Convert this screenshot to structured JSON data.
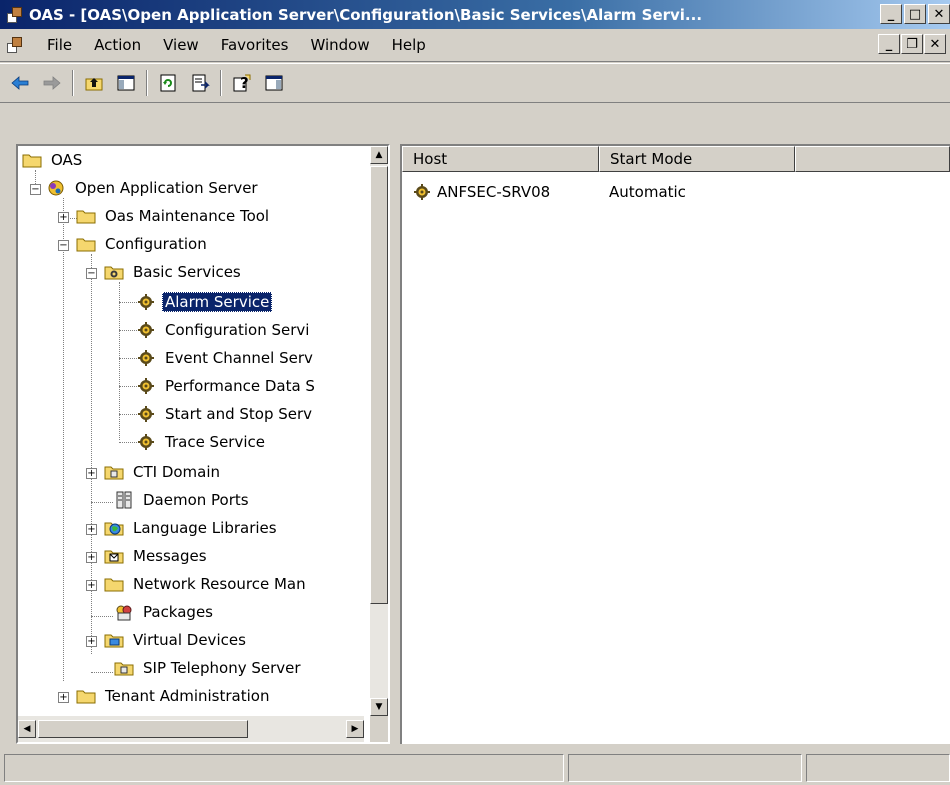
{
  "window": {
    "title": "OAS - [OAS\\Open Application Server\\Configuration\\Basic Services\\Alarm Servi...",
    "minimize": "_",
    "maximize": "□",
    "close": "✕"
  },
  "menubar": {
    "items": [
      {
        "label": "File"
      },
      {
        "label": "Action"
      },
      {
        "label": "View"
      },
      {
        "label": "Favorites"
      },
      {
        "label": "Window"
      },
      {
        "label": "Help"
      }
    ],
    "mdi_minimize": "_",
    "mdi_restore": "❐",
    "mdi_close": "✕"
  },
  "toolbar": {
    "icons": [
      "back-arrow-icon",
      "forward-arrow-icon",
      "up-one-level-icon",
      "show-hide-tree-icon",
      "refresh-icon",
      "export-list-icon",
      "help-icon",
      "show-hide-action-pane-icon"
    ]
  },
  "tree": {
    "items": [
      {
        "label": "OAS",
        "icon": "folder-icon",
        "selected": false
      },
      {
        "label": "Open Application Server",
        "icon": "server-icon",
        "expanded": true
      },
      {
        "label": "Oas Maintenance Tool",
        "icon": "folder-icon",
        "expanded": false
      },
      {
        "label": "Configuration",
        "icon": "folder-icon",
        "expanded": true
      },
      {
        "label": "Basic Services",
        "icon": "services-folder-icon",
        "expanded": true
      },
      {
        "label": "Alarm Service",
        "icon": "gear-service-icon",
        "selected": true
      },
      {
        "label": "Configuration Servi",
        "icon": "gear-service-icon"
      },
      {
        "label": "Event Channel Serv",
        "icon": "gear-service-icon"
      },
      {
        "label": "Performance Data S",
        "icon": "gear-service-icon"
      },
      {
        "label": "Start and Stop Serv",
        "icon": "gear-service-icon"
      },
      {
        "label": "Trace Service",
        "icon": "gear-service-icon"
      },
      {
        "label": "CTI Domain",
        "icon": "domain-icon",
        "expanded": false
      },
      {
        "label": "Daemon Ports",
        "icon": "ports-icon"
      },
      {
        "label": "Language Libraries",
        "icon": "globe-icon",
        "expanded": false
      },
      {
        "label": "Messages",
        "icon": "messages-icon",
        "expanded": false
      },
      {
        "label": "Network Resource Man",
        "icon": "folder-icon",
        "expanded": false
      },
      {
        "label": "Packages",
        "icon": "packages-icon"
      },
      {
        "label": "Virtual Devices",
        "icon": "virtual-device-icon",
        "expanded": false
      },
      {
        "label": "SIP Telephony Server",
        "icon": "domain-icon"
      },
      {
        "label": "Tenant Administration",
        "icon": "folder-icon",
        "expanded": false
      }
    ]
  },
  "list": {
    "columns": [
      "Host",
      "Start Mode",
      ""
    ],
    "rows": [
      {
        "host": "ANFSEC-SRV08",
        "start_mode": "Automatic"
      }
    ]
  },
  "statusbar": {
    "panels": [
      "",
      "",
      ""
    ]
  },
  "colors": {
    "selection": "#0a246a",
    "chrome": "#d4d0c8"
  }
}
